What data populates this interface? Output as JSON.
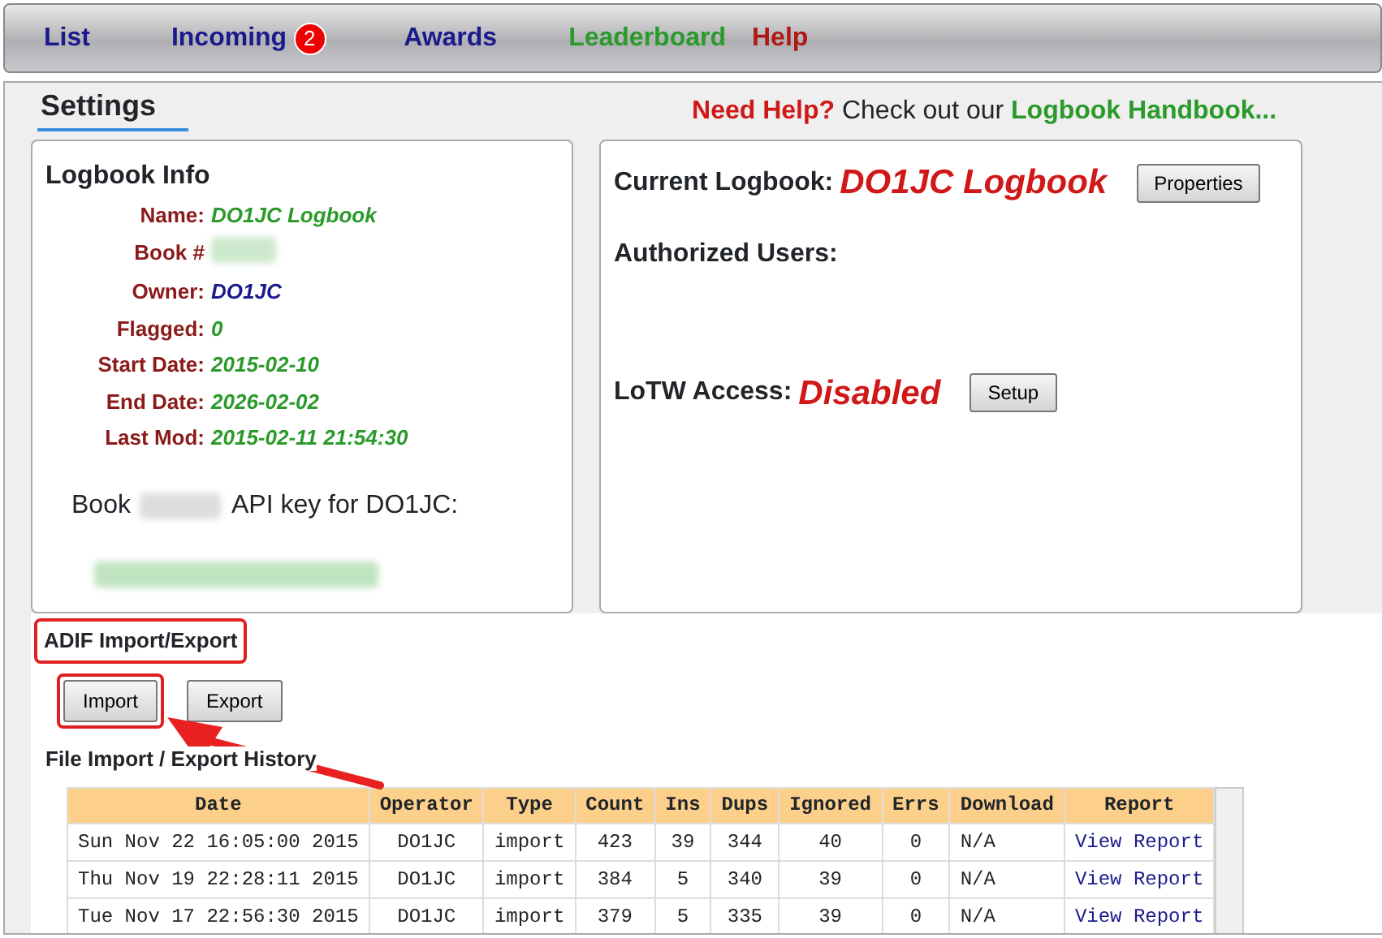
{
  "nav": [
    {
      "label": "List",
      "color": "#1a1a8c"
    },
    {
      "label": "Incoming",
      "color": "#1a1a8c",
      "badge": "2"
    },
    {
      "label": "Awards",
      "color": "#1a1a8c"
    },
    {
      "label": "Leaderboard",
      "color": "#2a9a2a"
    },
    {
      "label": "Help",
      "color": "#b01818"
    }
  ],
  "page_title": "Settings",
  "help_note": {
    "lead": "Need Help?",
    "text": "Check out our",
    "link": "Logbook Handbook..."
  },
  "logbook_info": {
    "title": "Logbook Info",
    "fields": [
      {
        "label": "Name:",
        "value": "DO1JC Logbook",
        "kind": "green"
      },
      {
        "label": "Book #",
        "kind": "blurred"
      },
      {
        "label": "Owner:",
        "value": "DO1JC",
        "kind": "blue"
      },
      {
        "label": "Flagged:",
        "value": "0",
        "kind": "green"
      },
      {
        "label": "Start Date:",
        "value": "2015-02-10",
        "kind": "green"
      },
      {
        "label": "End Date:",
        "value": "2026-02-02",
        "kind": "green"
      },
      {
        "label": "Last Mod:",
        "value": "2015-02-11 21:54:30",
        "kind": "green"
      }
    ],
    "api_line": {
      "before": "Book",
      "after": "API key for DO1JC:"
    }
  },
  "current_logbook": {
    "label": "Current Logbook:",
    "value": "DO1JC Logbook",
    "button": "Properties"
  },
  "authorized_users": {
    "label": "Authorized Users:"
  },
  "lotw": {
    "label": "LoTW Access:",
    "value": "Disabled",
    "button": "Setup"
  },
  "adif": {
    "title": "ADIF Import/Export",
    "buttons": [
      {
        "label": "Import",
        "highlighted": true
      },
      {
        "label": "Export",
        "highlighted": false
      }
    ]
  },
  "history": {
    "title": "File Import / Export History",
    "columns": [
      "Date",
      "Operator",
      "Type",
      "Count",
      "Ins",
      "Dups",
      "Ignored",
      "Errs",
      "Download",
      "Report"
    ],
    "rows": [
      [
        "Sun Nov 22 16:05:00 2015",
        "DO1JC",
        "import",
        "423",
        "39",
        "344",
        "40",
        "0",
        "N/A",
        "View Report"
      ],
      [
        "Thu Nov 19 22:28:11 2015",
        "DO1JC",
        "import",
        "384",
        "5",
        "340",
        "39",
        "0",
        "N/A",
        "View Report"
      ],
      [
        "Tue Nov 17 22:56:30 2015",
        "DO1JC",
        "import",
        "379",
        "5",
        "335",
        "39",
        "0",
        "N/A",
        "View Report"
      ]
    ]
  }
}
